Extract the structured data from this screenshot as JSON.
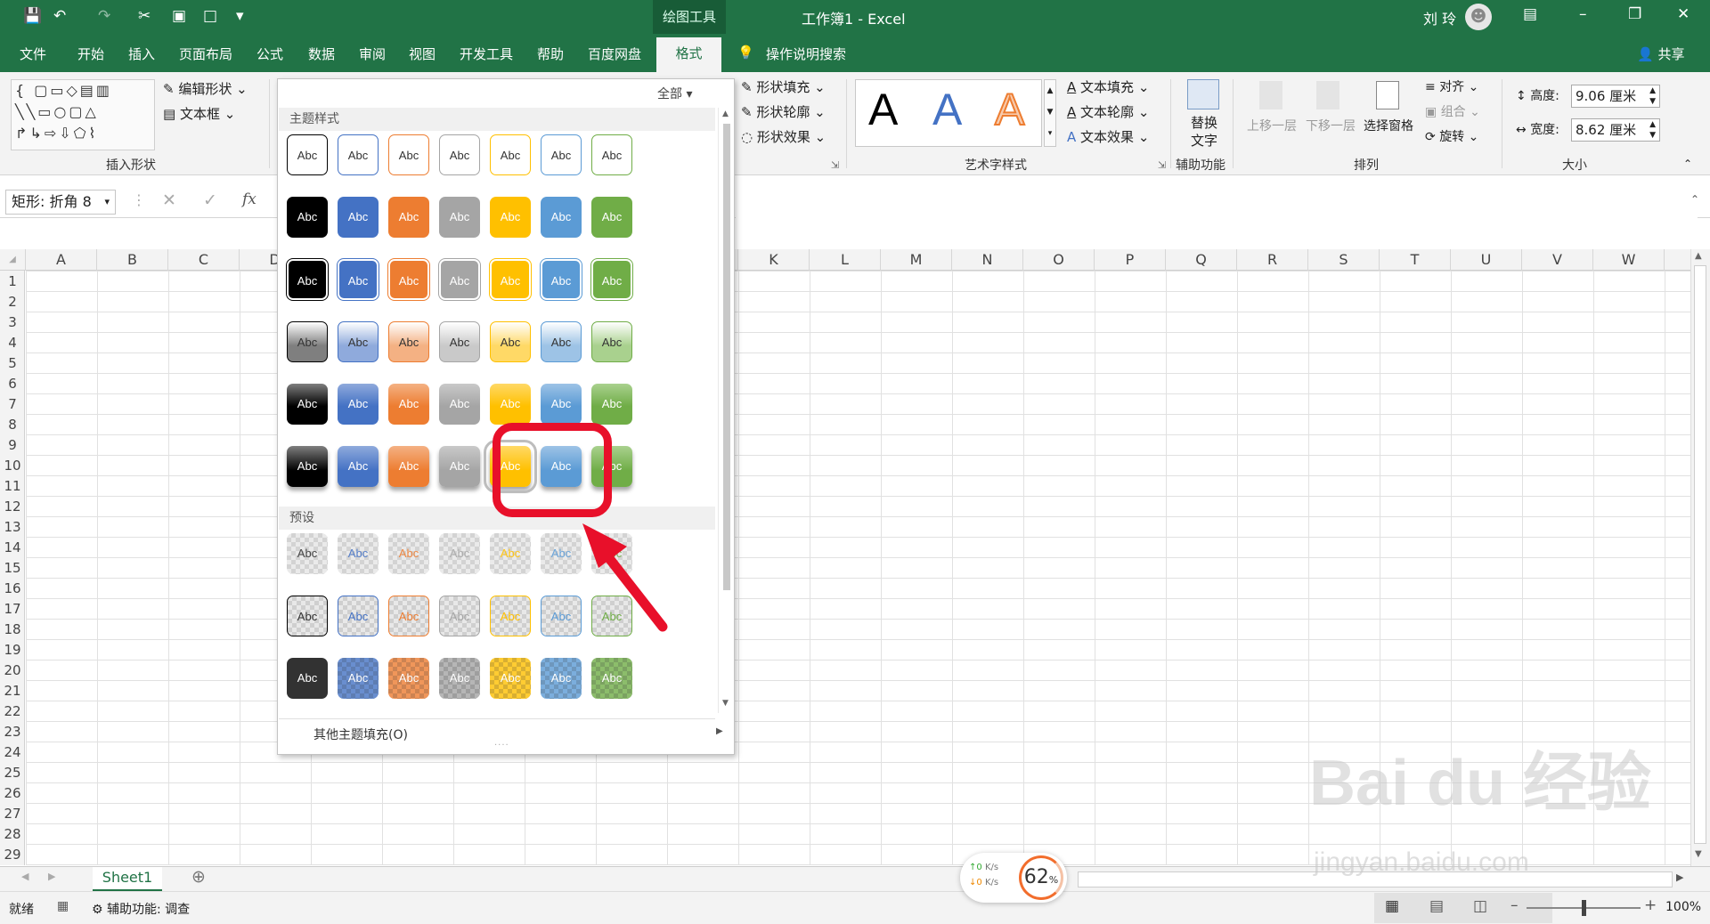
{
  "titlebar": {
    "drawing_tools": "绘图工具",
    "title": "工作簿1  -  Excel",
    "user": "刘 玲"
  },
  "menu": [
    "文件",
    "开始",
    "插入",
    "页面布局",
    "公式",
    "数据",
    "审阅",
    "视图",
    "开发工具",
    "帮助",
    "百度网盘",
    "格式",
    "操作说明搜索",
    "共享"
  ],
  "ribbon": {
    "edit_shape": "编辑形状",
    "text_box": "文本框",
    "insert_shapes_label": "插入形状",
    "shape_fill": "形状填充",
    "shape_outline": "形状轮廓",
    "shape_effects": "形状效果",
    "wordart_sample": "A",
    "text_fill": "文本填充",
    "text_outline": "文本轮廓",
    "text_effects": "文本效果",
    "wordart_label": "艺术字样式",
    "alt_text_1": "替换",
    "alt_text_2": "文字",
    "accessibility_label": "辅助功能",
    "bring_forward": "上移一层",
    "send_backward": "下移一层",
    "selection_pane": "选择窗格",
    "align": "对齐",
    "group": "组合",
    "rotate": "旋转",
    "arrange_label": "排列",
    "height_label": "高度:",
    "height_value": "9.06 厘米",
    "width_label": "宽度:",
    "width_value": "8.62 厘米",
    "size_label": "大小"
  },
  "formula_bar": {
    "name_box": "矩形: 折角 8",
    "fx": "fx"
  },
  "columns": [
    "A",
    "B",
    "C",
    "D",
    "E",
    "F",
    "G",
    "H",
    "I",
    "J",
    "K",
    "L",
    "M",
    "N",
    "O",
    "P",
    "Q",
    "R",
    "S",
    "T",
    "U",
    "V",
    "W"
  ],
  "rows": [
    "1",
    "2",
    "3",
    "4",
    "5",
    "6",
    "7",
    "8",
    "9",
    "10",
    "11",
    "12",
    "13",
    "14",
    "15",
    "16",
    "17",
    "18",
    "19",
    "20",
    "21",
    "22",
    "23",
    "24",
    "25",
    "26",
    "27",
    "28",
    "29"
  ],
  "sheet": {
    "tab": "Sheet1"
  },
  "status": {
    "ready": "就绪",
    "accessibility": "辅助功能: 调查",
    "zoom": "100%",
    "speed_up": "0",
    "speed_down": "0",
    "speed_unit": "K/s",
    "cpu": "62",
    "cpu_unit": "%"
  },
  "gallery": {
    "filter": "全部",
    "theme_section": "主题样式",
    "preset_section": "预设",
    "more_fills": "其他主题填充(O)",
    "tile_text": "Abc",
    "colors": [
      "#000000",
      "#4472c4",
      "#ed7d31",
      "#a5a5a5",
      "#ffc000",
      "#5b9bd5",
      "#70ad47"
    ],
    "light_colors": [
      "#7f7f7f",
      "#8faadc",
      "#f4b183",
      "#c9c9c9",
      "#ffd966",
      "#9dc3e6",
      "#a9d18e"
    ],
    "selected_row": 5,
    "selected_col": 4
  },
  "watermark": {
    "logo": "Bai du 经验",
    "url": "jingyan.baidu.com"
  }
}
